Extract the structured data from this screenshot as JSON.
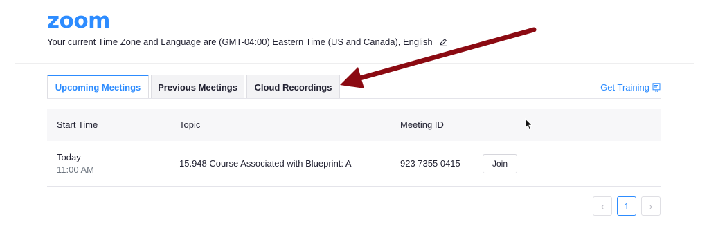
{
  "brand": {
    "logo": "zoom",
    "color": "#2d8cff"
  },
  "header": {
    "timezone_text": "Your current Time Zone and Language are (GMT-04:00) Eastern Time (US and Canada), English",
    "edit_icon": "pencil-icon"
  },
  "tabs": [
    {
      "label": "Upcoming Meetings",
      "active": true
    },
    {
      "label": "Previous Meetings",
      "active": false
    },
    {
      "label": "Cloud Recordings",
      "active": false
    }
  ],
  "training": {
    "label": "Get Training",
    "icon": "training-document-icon"
  },
  "table": {
    "headers": [
      "Start Time",
      "Topic",
      "Meeting ID"
    ],
    "rows": [
      {
        "day": "Today",
        "time": "11:00 AM",
        "topic": "15.948 Course Associated with Blueprint: A",
        "meeting_id": "923 7355 0415",
        "action": "Join"
      }
    ]
  },
  "pagination": {
    "prev": "‹",
    "current": "1",
    "next": "›"
  },
  "annotation": {
    "arrow_color": "#8b0a12"
  }
}
